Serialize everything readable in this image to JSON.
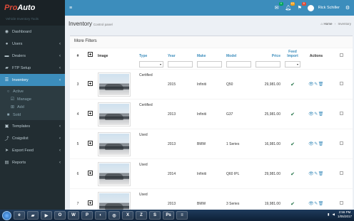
{
  "brand": {
    "pro": "Pro",
    "auto": "Auto",
    "subtitle": "Vehicle Inventory Tools"
  },
  "topbar": {
    "notifications": [
      {
        "icon": "envelope-icon",
        "count": "4",
        "color": "#00a65a"
      },
      {
        "icon": "bell-icon",
        "count": "10",
        "color": "#f39c12"
      },
      {
        "icon": "flag-icon",
        "count": "9",
        "color": "#dd4b39"
      }
    ],
    "user_name": "Rick Schiller"
  },
  "sidebar": {
    "items": [
      {
        "label": "Dashboard",
        "icon": "dashboard-icon"
      },
      {
        "label": "Users",
        "icon": "users-icon"
      },
      {
        "label": "Dealers",
        "icon": "car-icon"
      },
      {
        "label": "FTP Setup",
        "icon": "folder-icon"
      },
      {
        "label": "Inventory",
        "icon": "list-icon"
      },
      {
        "label": "Templates",
        "icon": "template-icon"
      },
      {
        "label": "Craigslist",
        "icon": "share-icon"
      },
      {
        "label": "Export Feed",
        "icon": "export-icon"
      },
      {
        "label": "Reports",
        "icon": "chart-icon"
      }
    ],
    "inventory_sub": {
      "active": "Active",
      "manage": "Manage",
      "add": "Add",
      "sold": "Sold"
    }
  },
  "header": {
    "title": "Inventory",
    "subtitle": "Control panel",
    "breadcrumb_home": "Home",
    "breadcrumb_current": "Inventory"
  },
  "box": {
    "title": "More Filters"
  },
  "table": {
    "columns": {
      "num": "#",
      "image": "Image",
      "type": "Type",
      "year": "Year",
      "make": "Make",
      "model": "Model",
      "price": "Price",
      "feed": "Feed Import",
      "actions": "Actions"
    },
    "rows": [
      {
        "num": "3",
        "type": "Certified",
        "year": "2015",
        "make": "Infiniti",
        "model": "Q50",
        "price": "29,981.00"
      },
      {
        "num": "4",
        "type": "Certified",
        "year": "2013",
        "make": "Infiniti",
        "model": "G37",
        "price": "25,981.00"
      },
      {
        "num": "5",
        "type": "Used",
        "year": "2013",
        "make": "BMW",
        "model": "1 Series",
        "price": "16,981.00"
      },
      {
        "num": "6",
        "type": "Used",
        "year": "2014",
        "make": "Infiniti",
        "model": "Q60 IPL",
        "price": "29,981.00"
      },
      {
        "num": "7",
        "type": "Used",
        "year": "2013",
        "make": "BMW",
        "model": "3 Series",
        "price": "19,981.00"
      }
    ]
  },
  "taskbar": {
    "time": "2:56 PM",
    "date": "1/05/2017"
  }
}
